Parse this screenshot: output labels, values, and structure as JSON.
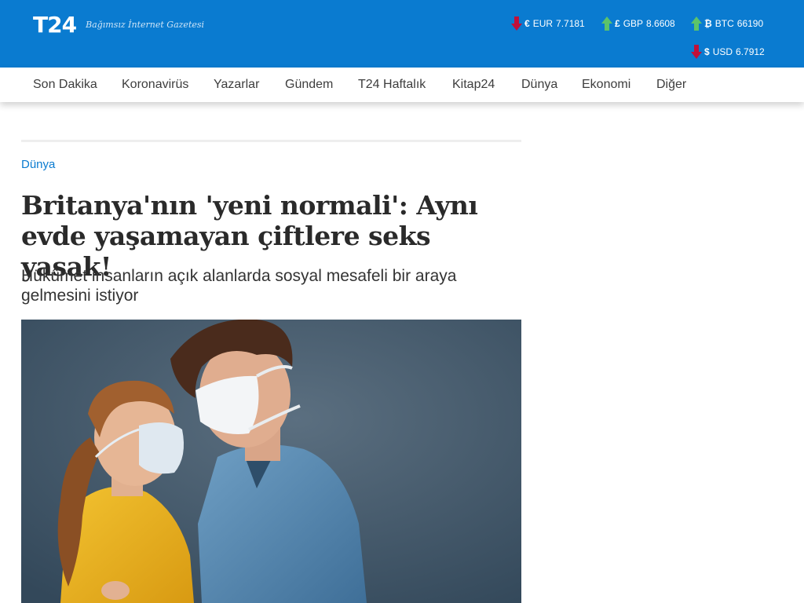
{
  "header": {
    "logo": "T24",
    "tagline": "Bağımsız İnternet Gazetesi",
    "colors": {
      "bar": "#0a7bd0",
      "up": "#5cc36a",
      "down": "#c0103a"
    },
    "rates": [
      {
        "symbol": "€",
        "code": "EUR",
        "value": "7.7181",
        "trend": "down"
      },
      {
        "symbol": "£",
        "code": "GBP",
        "value": "8.6608",
        "trend": "up"
      },
      {
        "symbol": "₿",
        "code": "BTC",
        "value": "66190",
        "trend": "up"
      },
      {
        "symbol": "$",
        "code": "USD",
        "value": "6.7912",
        "trend": "down"
      }
    ]
  },
  "nav": {
    "items": [
      "Son Dakika",
      "Koronavirüs",
      "Yazarlar",
      "Gündem",
      "T24 Haftalık",
      "Kitap24",
      "Dünya",
      "Ekonomi",
      "Diğer"
    ]
  },
  "article": {
    "category": "Dünya",
    "title": "Britanya'nın 'yeni normali': Aynı evde yaşamayan çiftlere seks yasak!",
    "subtitle": "Hükûmet insanların açık alanlarda sosyal mesafeli bir araya gelmesini istiyor",
    "image_subject": "couple-wearing-face-masks"
  }
}
